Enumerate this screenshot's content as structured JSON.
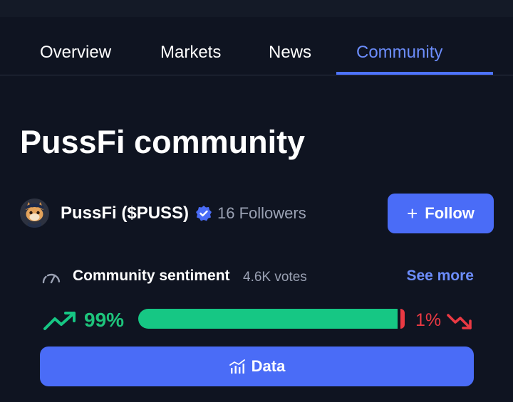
{
  "tabs": [
    {
      "label": "Overview"
    },
    {
      "label": "Markets"
    },
    {
      "label": "News"
    },
    {
      "label": "Community",
      "active": true
    }
  ],
  "page": {
    "title": "PussFi community"
  },
  "profile": {
    "avatar_icon": "cat-avatar-icon",
    "name": "PussFi ($PUSS)",
    "verified_icon": "verified-badge-icon",
    "followers": "16 Followers",
    "follow_label": "Follow",
    "follow_icon": "plus-icon"
  },
  "sentiment": {
    "title": "Community sentiment",
    "votes": "4.6K votes",
    "see_more": "See more",
    "bullish_label": "99%",
    "bearish_label": "1%",
    "bullish_fraction": 0.99,
    "bearish_fraction": 0.01,
    "data_button": "Data"
  },
  "colors": {
    "background": "#0f1421",
    "accent": "#4a6cf7",
    "active_tab": "#6c8dfc",
    "bullish": "#16c784",
    "bearish": "#ea3943"
  }
}
